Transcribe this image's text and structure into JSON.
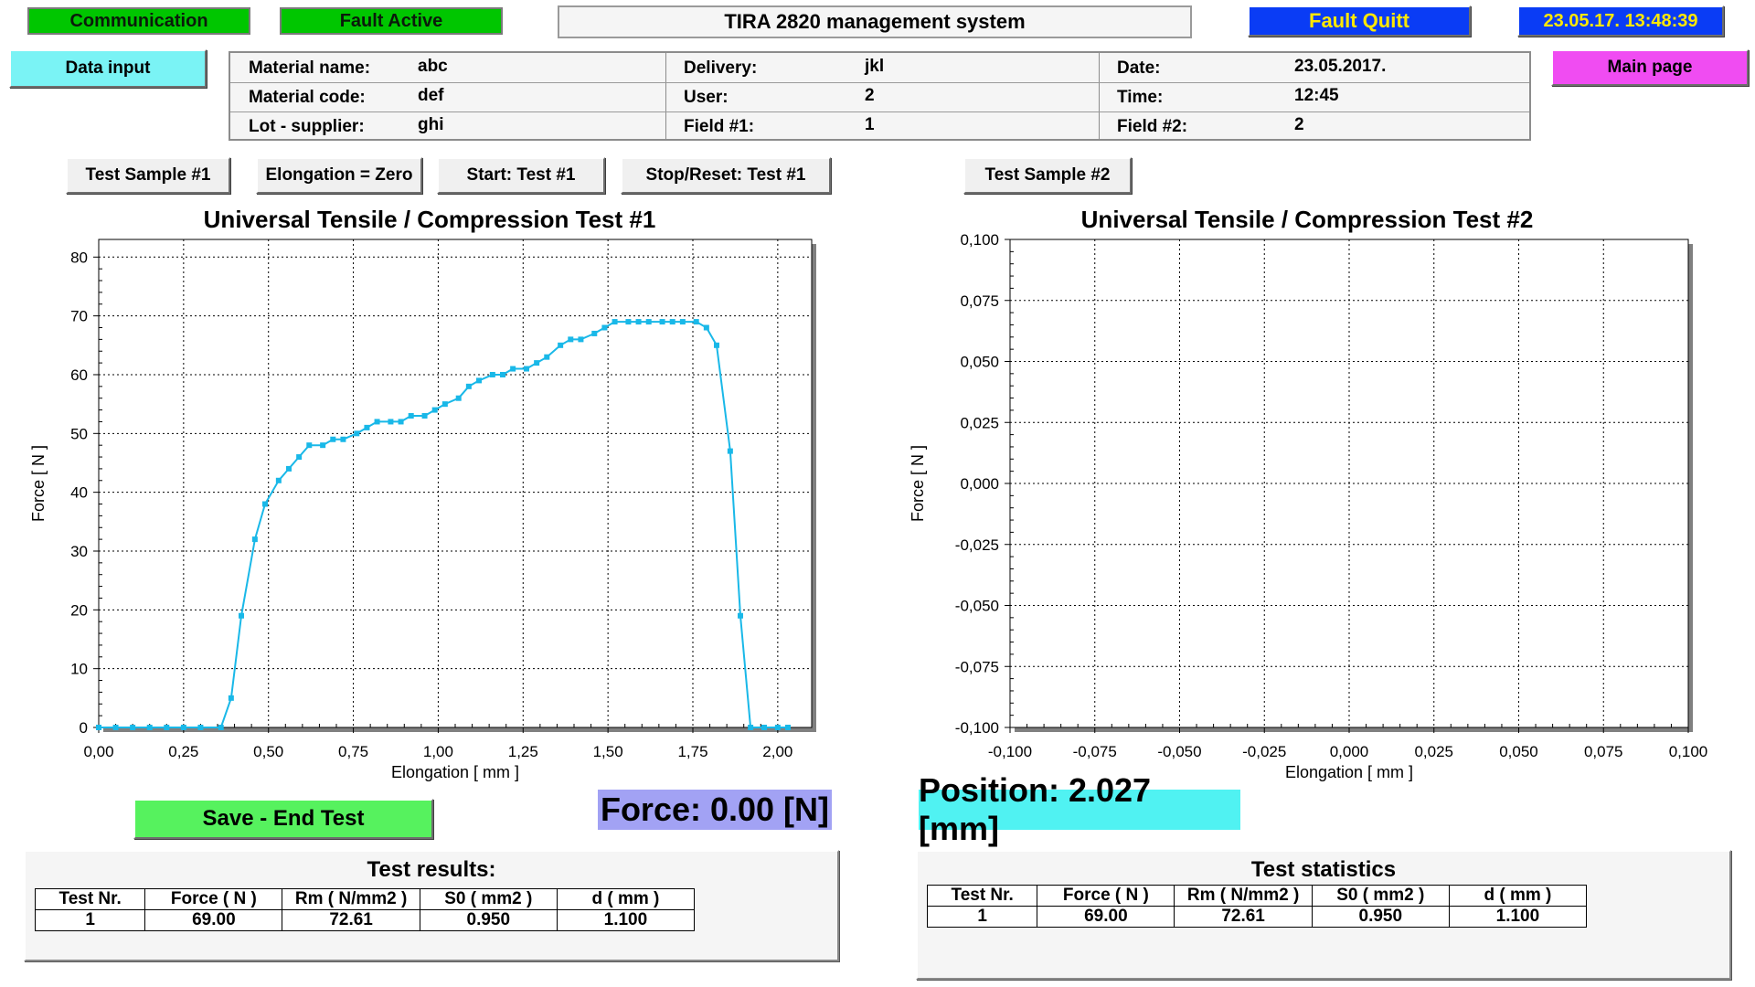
{
  "header": {
    "communication": "Communication",
    "fault_active": "Fault Active",
    "title": "TIRA 2820 management system",
    "fault_quitt": "Fault Quitt",
    "datetime": "23.05.17. 13:48:39"
  },
  "buttons": {
    "data_input": "Data input",
    "main_page": "Main page",
    "test_sample_1": "Test Sample #1",
    "elongation_zero": "Elongation = Zero",
    "start_test_1": "Start: Test #1",
    "stop_reset_test_1": "Stop/Reset: Test #1",
    "test_sample_2": "Test Sample #2",
    "save_end_test": "Save - End Test"
  },
  "info": {
    "material_name_label": "Material name:",
    "material_name": "abc",
    "material_code_label": "Material code:",
    "material_code": "def",
    "lot_supplier_label": "Lot - supplier:",
    "lot_supplier": "ghi",
    "delivery_label": "Delivery:",
    "delivery": "jkl",
    "user_label": "User:",
    "user": "2",
    "field1_label": "Field #1:",
    "field1": "1",
    "date_label": "Date:",
    "date": "23.05.2017.",
    "time_label": "Time:",
    "time": "12:45",
    "field2_label": "Field #2:",
    "field2": "2"
  },
  "chart_data": [
    {
      "type": "line",
      "title": "Universal Tensile / Compression Test #1",
      "xlabel": "Elongation [ mm ]",
      "ylabel": "Force [ N ]",
      "xlim": [
        0,
        2.1
      ],
      "ylim": [
        0,
        83
      ],
      "xticks": [
        "0,00",
        "0,25",
        "0,50",
        "0,75",
        "1,00",
        "1,25",
        "1,50",
        "1,75",
        "2,00"
      ],
      "yticks": [
        "0",
        "10",
        "20",
        "30",
        "40",
        "50",
        "60",
        "70",
        "80"
      ],
      "grid": true,
      "series": [
        {
          "color": "#19b8e8",
          "x": [
            0,
            0.05,
            0.1,
            0.15,
            0.2,
            0.25,
            0.3,
            0.36,
            0.39,
            0.42,
            0.46,
            0.49,
            0.53,
            0.56,
            0.59,
            0.62,
            0.66,
            0.69,
            0.72,
            0.76,
            0.79,
            0.82,
            0.86,
            0.89,
            0.92,
            0.96,
            0.99,
            1.02,
            1.06,
            1.09,
            1.12,
            1.16,
            1.19,
            1.22,
            1.26,
            1.29,
            1.32,
            1.36,
            1.39,
            1.42,
            1.46,
            1.49,
            1.52,
            1.56,
            1.59,
            1.62,
            1.66,
            1.69,
            1.72,
            1.76,
            1.79,
            1.82,
            1.86,
            1.89,
            1.92,
            1.96,
            2.0,
            2.03
          ],
          "y": [
            0,
            0,
            0,
            0,
            0,
            0,
            0,
            0,
            5,
            19,
            32,
            38,
            42,
            44,
            46,
            48,
            48,
            49,
            49,
            50,
            51,
            52,
            52,
            52,
            53,
            53,
            54,
            55,
            56,
            58,
            59,
            60,
            60,
            61,
            61,
            62,
            63,
            65,
            66,
            66,
            67,
            68,
            69,
            69,
            69,
            69,
            69,
            69,
            69,
            69,
            68,
            65,
            47,
            19,
            0,
            0,
            0,
            0
          ]
        }
      ]
    },
    {
      "type": "line",
      "title": "Universal Tensile / Compression Test #2",
      "xlabel": "Elongation [ mm ]",
      "ylabel": "Force [ N ]",
      "xlim": [
        -0.1,
        0.1
      ],
      "ylim": [
        -0.1,
        0.1
      ],
      "xticks": [
        "-0,100",
        "-0,075",
        "-0,050",
        "-0,025",
        "0,000",
        "0,025",
        "0,050",
        "0,075",
        "0,100"
      ],
      "yticks": [
        "-0,100",
        "-0,075",
        "-0,050",
        "-0,025",
        "0,000",
        "0,025",
        "0,050",
        "0,075",
        "0,100"
      ],
      "grid": true,
      "series": []
    }
  ],
  "readouts": {
    "force": "Force: 0.00 [N]",
    "position": "Position: 2.027 [mm]"
  },
  "results": {
    "title": "Test results:",
    "headers": [
      "Test Nr.",
      "Force ( N )",
      "Rm ( N/mm2 )",
      "S0 ( mm2 )",
      "d ( mm )"
    ],
    "row": [
      "1",
      "69.00",
      "72.61",
      "0.950",
      "1.100"
    ]
  },
  "statistics": {
    "title": "Test statistics",
    "headers": [
      "Test Nr.",
      "Force ( N )",
      "Rm ( N/mm2 )",
      "S0 ( mm2 )",
      "d ( mm )"
    ],
    "row": [
      "1",
      "69.00",
      "72.61",
      "0.950",
      "1.100"
    ]
  },
  "colors": {
    "status_green": "#00c600",
    "fault_quitt_blue": "#0a3cf5",
    "datetime_blue": "#0a3cf5",
    "data_input_cyan": "#7af3f5",
    "main_page_magenta": "#f04cf2",
    "save_green": "#56f25e",
    "force_purple": "#a2a2f4",
    "position_cyan": "#50f2f2",
    "series_cyan": "#19b8e8"
  }
}
